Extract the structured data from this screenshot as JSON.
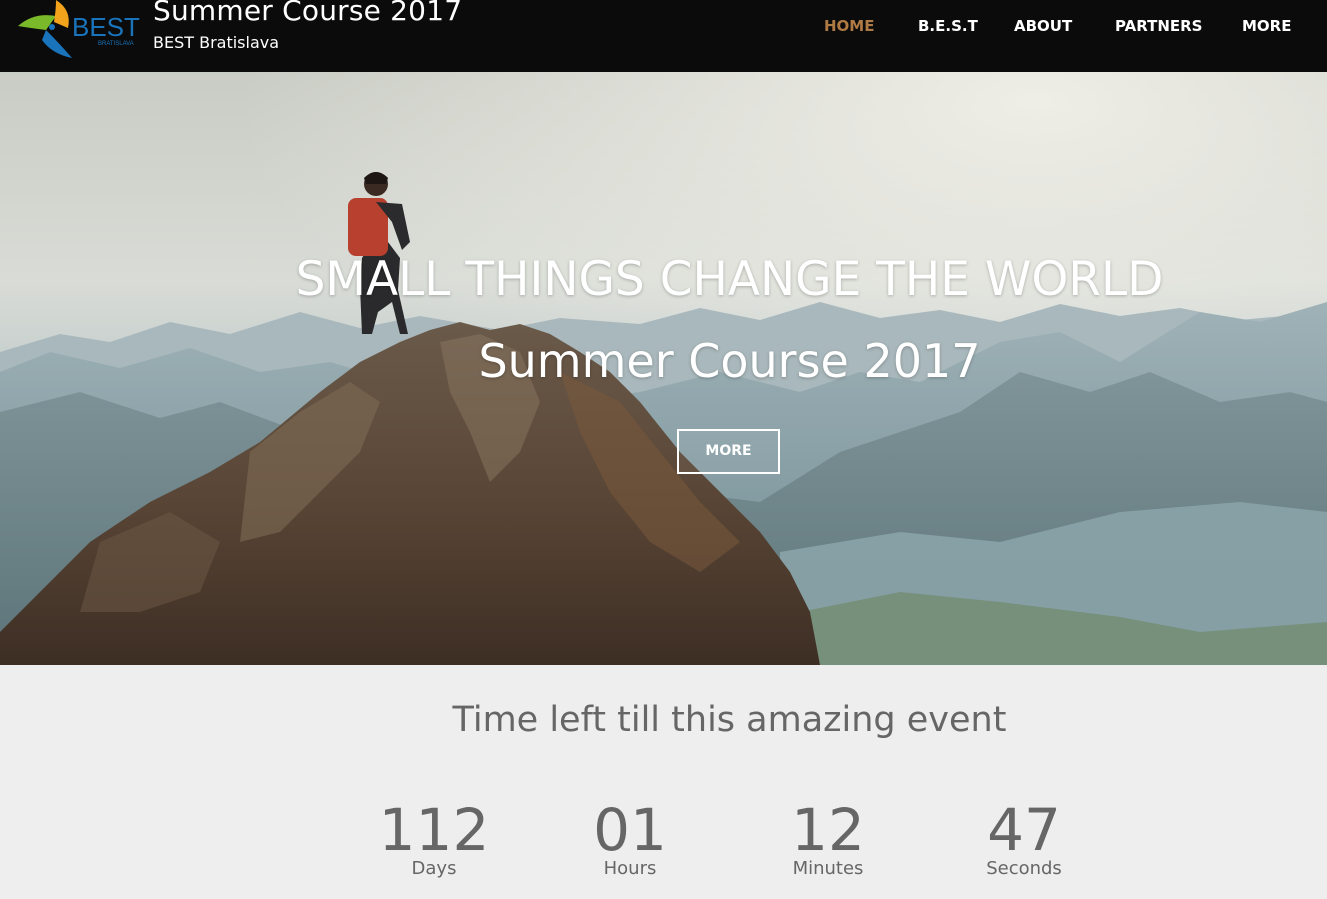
{
  "header": {
    "logo_text": "BEST",
    "logo_subtext": "BRATISLAVA",
    "title": "Summer Course 2017",
    "subtitle": "BEST Bratislava"
  },
  "nav": {
    "items": [
      {
        "label": "HOME",
        "active": true
      },
      {
        "label": "B.E.S.T",
        "active": false
      },
      {
        "label": "ABOUT",
        "active": false
      },
      {
        "label": "PARTNERS",
        "active": false
      },
      {
        "label": "MORE",
        "active": false
      }
    ]
  },
  "hero": {
    "headline": "SMALL THINGS CHANGE THE WORLD",
    "subline": "Summer Course 2017",
    "button_label": "MORE"
  },
  "countdown": {
    "title": "Time left till this amazing event",
    "units": [
      {
        "value": "112",
        "label": "Days"
      },
      {
        "value": "01",
        "label": "Hours"
      },
      {
        "value": "12",
        "label": "Minutes"
      },
      {
        "value": "47",
        "label": "Seconds"
      }
    ]
  },
  "colors": {
    "header_bg": "#0b0b0b",
    "nav_active": "#b07a44",
    "countdown_bg": "#eeeeee",
    "countdown_text": "#666666"
  }
}
